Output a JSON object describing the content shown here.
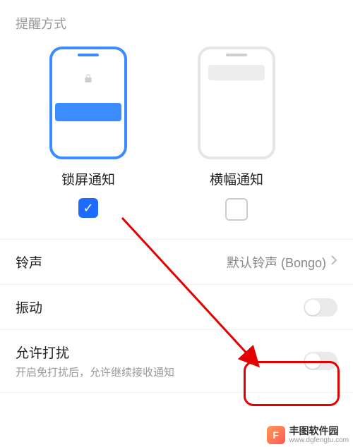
{
  "section_title": "提醒方式",
  "options": {
    "lockscreen": {
      "label": "锁屏通知",
      "checked": true
    },
    "banner": {
      "label": "横幅通知",
      "checked": false
    }
  },
  "rows": {
    "ringtone": {
      "label": "铃声",
      "value": "默认铃声 (Bongo)"
    },
    "vibrate": {
      "label": "振动",
      "on": false
    },
    "allow_disturb": {
      "label": "允许打扰",
      "sub": "开启免打扰后，允许继续接收通知",
      "on": false
    }
  },
  "watermark": {
    "title": "丰图软件园",
    "url": "www.dgfengtu.com",
    "logo_initial": "F"
  },
  "icons": {
    "lock": "lock-icon",
    "chevron": "chevron-right-icon",
    "check": "checkmark-icon"
  }
}
